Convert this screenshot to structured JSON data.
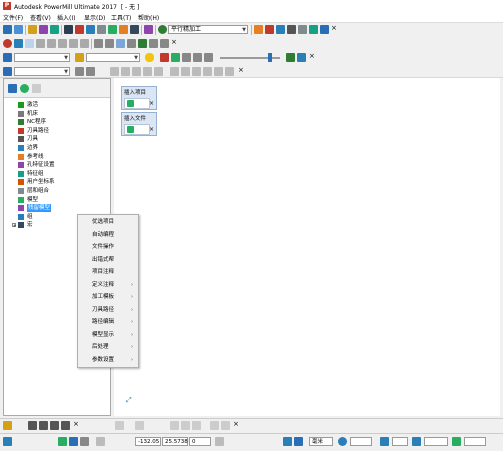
{
  "window": {
    "app_title": "Autodesk PowerMill Ultimate 2017",
    "doc_title": "[ - 无 ]",
    "logo_letter": "P"
  },
  "menubar": {
    "items": [
      "文件(F)",
      "查看(V)",
      "插入(I)",
      "显示(D)",
      "工具(T)",
      "帮助(H)"
    ]
  },
  "toolbar1": {
    "strategy_combo": "平行精加工"
  },
  "explorer": {
    "items": [
      {
        "label": "激活",
        "icon": "activate-icon",
        "color": "#1a9a1a",
        "expand": ""
      },
      {
        "label": "机床",
        "icon": "machine-icon",
        "color": "#7a7a7a",
        "expand": ""
      },
      {
        "label": "NC程序",
        "icon": "nc-program-icon",
        "color": "#2e7d32",
        "expand": ""
      },
      {
        "label": "刀具路径",
        "icon": "toolpath-icon",
        "color": "#c0392b",
        "expand": ""
      },
      {
        "label": "刀具",
        "icon": "tool-icon",
        "color": "#555555",
        "expand": ""
      },
      {
        "label": "边界",
        "icon": "boundary-icon",
        "color": "#2c7fb8",
        "expand": ""
      },
      {
        "label": "参考线",
        "icon": "pattern-icon",
        "color": "#e67e22",
        "expand": ""
      },
      {
        "label": "孔特征设置",
        "icon": "hole-feature-icon",
        "color": "#8e44ad",
        "expand": ""
      },
      {
        "label": "特征组",
        "icon": "feature-group-icon",
        "color": "#16a085",
        "expand": ""
      },
      {
        "label": "用户坐标系",
        "icon": "workplane-icon",
        "color": "#d35400",
        "expand": ""
      },
      {
        "label": "层和组合",
        "icon": "layers-icon",
        "color": "#7f8c8d",
        "expand": ""
      },
      {
        "label": "模型",
        "icon": "model-icon",
        "color": "#27ae60",
        "expand": ""
      },
      {
        "label": "残留模型",
        "icon": "stock-model-icon",
        "color": "#8e44ad",
        "expand": "",
        "selected": true
      },
      {
        "label": "组",
        "icon": "group-icon",
        "color": "#2980b9",
        "expand": ""
      },
      {
        "label": "宏",
        "icon": "macro-icon",
        "color": "#34495e",
        "expand": "+"
      }
    ]
  },
  "context_menu": {
    "items": [
      {
        "label": "优选项目",
        "submenu": ""
      },
      {
        "label": "自动编程",
        "submenu": ""
      },
      {
        "label": "文件操作",
        "submenu": ""
      },
      {
        "label": "出错式帮",
        "submenu": ""
      },
      {
        "label": "项目注释",
        "submenu": ""
      },
      {
        "label": "定义注释",
        "submenu": "›"
      },
      {
        "label": "加工模板",
        "submenu": "›"
      },
      {
        "label": "刀具路径",
        "submenu": "›"
      },
      {
        "label": "路径编辑",
        "submenu": "›"
      },
      {
        "label": "模型显示",
        "submenu": "›"
      },
      {
        "label": "后处理",
        "submenu": "›"
      },
      {
        "label": "参数设置",
        "submenu": "›"
      }
    ]
  },
  "viewport": {
    "cards": [
      {
        "title": "插入项目",
        "close": "×"
      },
      {
        "title": "插入文件",
        "close": "×"
      }
    ]
  },
  "status": {
    "x": "-132.05",
    "y": "25.5738",
    "z": "0",
    "units": "毫米"
  }
}
